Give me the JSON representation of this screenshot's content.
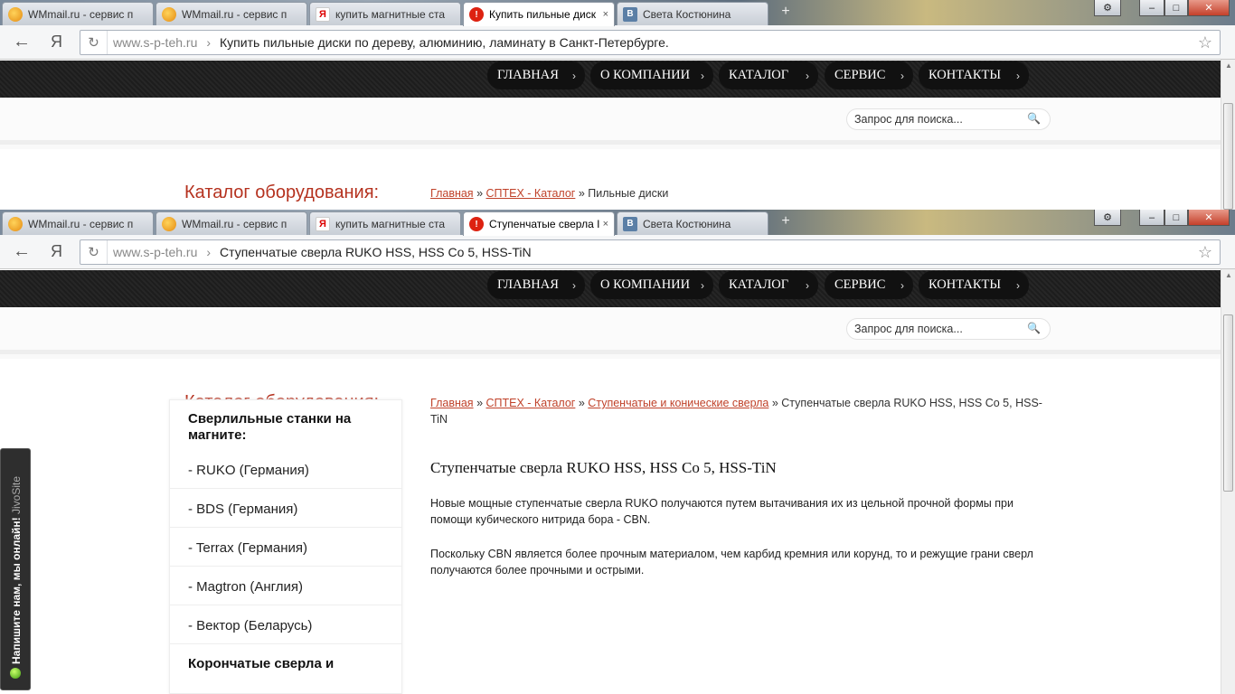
{
  "windows": [
    {
      "tabs": [
        {
          "label": "WMmail.ru - сервис п",
          "icon": "wmmail-icon",
          "active": false
        },
        {
          "label": "WMmail.ru - сервис п",
          "icon": "wmmail-icon",
          "active": false
        },
        {
          "label": "купить магнитные ста",
          "icon": "yandex-icon",
          "active": false
        },
        {
          "label": "Купить пильные диск",
          "icon": "error-icon",
          "active": true
        },
        {
          "label": "Света Костюнина",
          "icon": "vk-icon",
          "active": false
        }
      ],
      "address": {
        "domain": "www.s-p-teh.ru",
        "separator": "›",
        "title": "Купить пильные диски по дереву, алюминию, ламинату в Санкт-Петербурге."
      },
      "breadcrumb": {
        "links": [
          "Главная",
          "СПТЕХ - Каталог"
        ],
        "current": "Пильные диски"
      }
    },
    {
      "tabs": [
        {
          "label": "WMmail.ru - сервис п",
          "icon": "wmmail-icon",
          "active": false
        },
        {
          "label": "WMmail.ru - сервис п",
          "icon": "wmmail-icon",
          "active": false
        },
        {
          "label": "купить магнитные ста",
          "icon": "yandex-icon",
          "active": false
        },
        {
          "label": "Ступенчатые сверла I",
          "icon": "error-icon",
          "active": true
        },
        {
          "label": "Света Костюнина",
          "icon": "vk-icon",
          "active": false
        }
      ],
      "address": {
        "domain": "www.s-p-teh.ru",
        "separator": "›",
        "title": "Ступенчатые сверла RUKO HSS, HSS Co 5, HSS-TiN"
      },
      "breadcrumb": {
        "links": [
          "Главная",
          "СПТЕХ - Каталог",
          "Ступенчатые и конические сверла"
        ],
        "current": "Ступенчатые сверла RUKO HSS, HSS Co 5, HSS-TiN"
      }
    }
  ],
  "browser": {
    "back": "←",
    "yandex": "Я",
    "reload": "↻",
    "star": "☆",
    "new_tab": "+",
    "tab_close": "×",
    "settings": "⚙",
    "minimize": "–",
    "maximize": "□",
    "close": "✕"
  },
  "nav": {
    "items": [
      "ГЛАВНАЯ",
      "О КОМПАНИИ",
      "КАТАЛОГ",
      "СЕРВИС",
      "КОНТАКТЫ"
    ],
    "chevron": "›"
  },
  "search": {
    "placeholder": "Запрос для поиска...",
    "icon": "🔍"
  },
  "catalog_title": "Каталог оборудования:",
  "breadcrumb_sep": "»",
  "sidebar": {
    "heading": "Сверлильные станки на магните:",
    "items": [
      "- RUKO (Германия)",
      "- BDS (Германия)",
      "- Terrax (Германия)",
      "- Magtron (Англия)",
      "- Вектор (Беларусь)"
    ],
    "next_heading": "Корончатые сверла и"
  },
  "article": {
    "title": "Ступенчатые сверла RUKO HSS, HSS Co 5, HSS-TiN",
    "p1": "Новые мощные ступенчатые сверла RUKO получаются путем вытачивания их из цельной прочной формы при помощи кубического нитрида бора - CBN.",
    "p2": "Поскольку CBN является более прочным материалом, чем карбид кремния или корунд, то и режущие грани сверл получаются более прочными и острыми."
  },
  "jivo": {
    "text": "Напишите нам, мы онлайн!",
    "brand": "JivoSite"
  }
}
